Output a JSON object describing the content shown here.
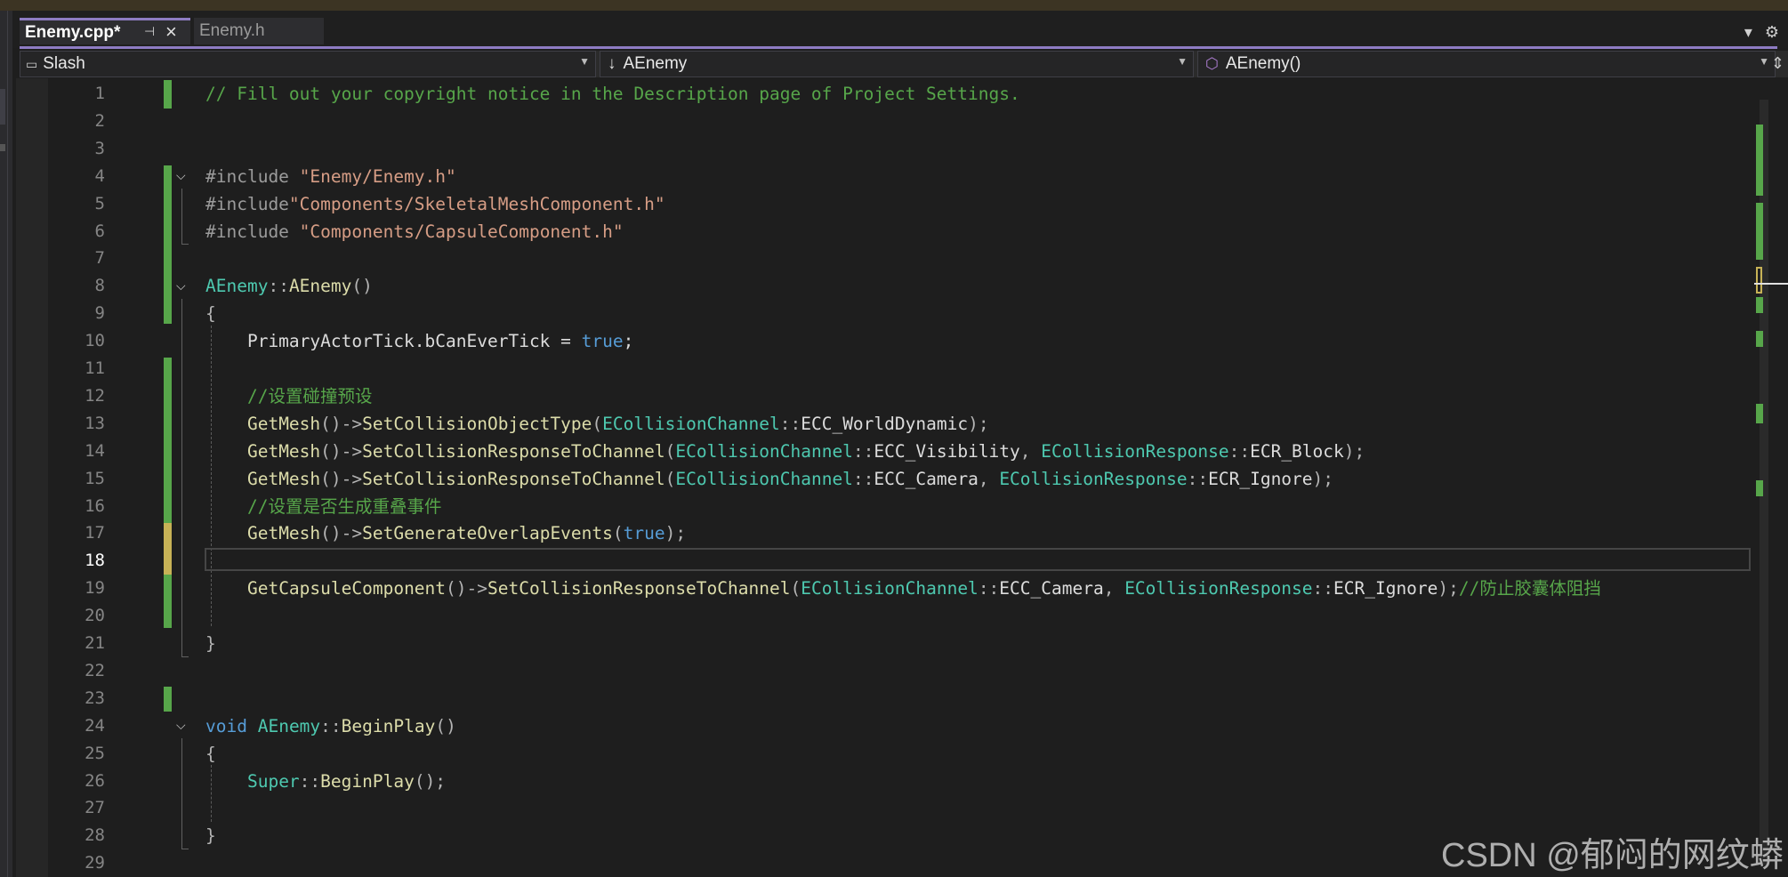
{
  "tabs": [
    {
      "label": "Enemy.cpp*",
      "active": true
    },
    {
      "label": "Enemy.h",
      "active": false
    }
  ],
  "navbar": {
    "project": "Slash",
    "scope": "AEnemy",
    "member": "AEnemy()"
  },
  "editor": {
    "current_line": 18,
    "lines": [
      {
        "n": "1",
        "segs": [
          {
            "t": "// Fill out your copyright notice in the Description page of Project Settings.",
            "c": "cmt"
          }
        ]
      },
      {
        "n": "2",
        "segs": []
      },
      {
        "n": "3",
        "segs": []
      },
      {
        "n": "4",
        "segs": [
          {
            "t": "#include ",
            "c": "inc"
          },
          {
            "t": "\"Enemy/Enemy.h\"",
            "c": "str"
          }
        ]
      },
      {
        "n": "5",
        "segs": [
          {
            "t": "#include",
            "c": "inc"
          },
          {
            "t": "\"Components/SkeletalMeshComponent.h\"",
            "c": "str"
          }
        ]
      },
      {
        "n": "6",
        "segs": [
          {
            "t": "#include ",
            "c": "inc"
          },
          {
            "t": "\"Components/CapsuleComponent.h\"",
            "c": "str"
          }
        ]
      },
      {
        "n": "7",
        "segs": []
      },
      {
        "n": "8",
        "segs": [
          {
            "t": "AEnemy",
            "c": "type"
          },
          {
            "t": "::",
            "c": "op"
          },
          {
            "t": "AEnemy",
            "c": "fn"
          },
          {
            "t": "()",
            "c": "op"
          }
        ]
      },
      {
        "n": "9",
        "segs": [
          {
            "t": "{",
            "c": "op"
          }
        ]
      },
      {
        "n": "10",
        "segs": [
          {
            "t": "    PrimaryActorTick.bCanEverTick = ",
            "c": ""
          },
          {
            "t": "true",
            "c": "kw"
          },
          {
            "t": ";",
            "c": ""
          }
        ]
      },
      {
        "n": "11",
        "segs": []
      },
      {
        "n": "12",
        "segs": [
          {
            "t": "    //设置碰撞预设",
            "c": "cmt"
          }
        ]
      },
      {
        "n": "13",
        "segs": [
          {
            "t": "    ",
            "c": ""
          },
          {
            "t": "GetMesh",
            "c": "fn"
          },
          {
            "t": "()->",
            "c": "op"
          },
          {
            "t": "SetCollisionObjectType",
            "c": "fn"
          },
          {
            "t": "(",
            "c": "op"
          },
          {
            "t": "ECollisionChannel",
            "c": "type"
          },
          {
            "t": "::",
            "c": "op"
          },
          {
            "t": "ECC_WorldDynamic",
            "c": ""
          },
          {
            "t": ");",
            "c": "op"
          }
        ]
      },
      {
        "n": "14",
        "segs": [
          {
            "t": "    ",
            "c": ""
          },
          {
            "t": "GetMesh",
            "c": "fn"
          },
          {
            "t": "()->",
            "c": "op"
          },
          {
            "t": "SetCollisionResponseToChannel",
            "c": "fn"
          },
          {
            "t": "(",
            "c": "op"
          },
          {
            "t": "ECollisionChannel",
            "c": "type"
          },
          {
            "t": "::",
            "c": "op"
          },
          {
            "t": "ECC_Visibility",
            "c": ""
          },
          {
            "t": ", ",
            "c": "op"
          },
          {
            "t": "ECollisionResponse",
            "c": "type"
          },
          {
            "t": "::",
            "c": "op"
          },
          {
            "t": "ECR_Block",
            "c": ""
          },
          {
            "t": ");",
            "c": "op"
          }
        ]
      },
      {
        "n": "15",
        "segs": [
          {
            "t": "    ",
            "c": ""
          },
          {
            "t": "GetMesh",
            "c": "fn"
          },
          {
            "t": "()->",
            "c": "op"
          },
          {
            "t": "SetCollisionResponseToChannel",
            "c": "fn"
          },
          {
            "t": "(",
            "c": "op"
          },
          {
            "t": "ECollisionChannel",
            "c": "type"
          },
          {
            "t": "::",
            "c": "op"
          },
          {
            "t": "ECC_Camera",
            "c": ""
          },
          {
            "t": ", ",
            "c": "op"
          },
          {
            "t": "ECollisionResponse",
            "c": "type"
          },
          {
            "t": "::",
            "c": "op"
          },
          {
            "t": "ECR_Ignore",
            "c": ""
          },
          {
            "t": ");",
            "c": "op"
          }
        ]
      },
      {
        "n": "16",
        "segs": [
          {
            "t": "    //设置是否生成重叠事件",
            "c": "cmt"
          }
        ]
      },
      {
        "n": "17",
        "segs": [
          {
            "t": "    ",
            "c": ""
          },
          {
            "t": "GetMesh",
            "c": "fn"
          },
          {
            "t": "()->",
            "c": "op"
          },
          {
            "t": "SetGenerateOverlapEvents",
            "c": "fn"
          },
          {
            "t": "(",
            "c": "op"
          },
          {
            "t": "true",
            "c": "kw"
          },
          {
            "t": ");",
            "c": "op"
          }
        ]
      },
      {
        "n": "18",
        "segs": []
      },
      {
        "n": "19",
        "segs": [
          {
            "t": "    ",
            "c": ""
          },
          {
            "t": "GetCapsuleComponent",
            "c": "fn"
          },
          {
            "t": "()->",
            "c": "op"
          },
          {
            "t": "SetCollisionResponseToChannel",
            "c": "fn"
          },
          {
            "t": "(",
            "c": "op"
          },
          {
            "t": "ECollisionChannel",
            "c": "type"
          },
          {
            "t": "::",
            "c": "op"
          },
          {
            "t": "ECC_Camera",
            "c": ""
          },
          {
            "t": ", ",
            "c": "op"
          },
          {
            "t": "ECollisionResponse",
            "c": "type"
          },
          {
            "t": "::",
            "c": "op"
          },
          {
            "t": "ECR_Ignore",
            "c": ""
          },
          {
            "t": ");",
            "c": "op"
          },
          {
            "t": "//防止胶囊体阻挡",
            "c": "cmt"
          }
        ]
      },
      {
        "n": "20",
        "segs": []
      },
      {
        "n": "21",
        "segs": [
          {
            "t": "}",
            "c": "op"
          }
        ]
      },
      {
        "n": "22",
        "segs": []
      },
      {
        "n": "23",
        "segs": []
      },
      {
        "n": "24",
        "segs": [
          {
            "t": "void",
            "c": "kw"
          },
          {
            "t": " ",
            "c": ""
          },
          {
            "t": "AEnemy",
            "c": "type"
          },
          {
            "t": "::",
            "c": "op"
          },
          {
            "t": "BeginPlay",
            "c": "fn"
          },
          {
            "t": "()",
            "c": "op"
          }
        ]
      },
      {
        "n": "25",
        "segs": [
          {
            "t": "{",
            "c": "op"
          }
        ]
      },
      {
        "n": "26",
        "segs": [
          {
            "t": "    ",
            "c": ""
          },
          {
            "t": "Super",
            "c": "type"
          },
          {
            "t": "::",
            "c": "op"
          },
          {
            "t": "BeginPlay",
            "c": "fn"
          },
          {
            "t": "();",
            "c": "op"
          }
        ]
      },
      {
        "n": "27",
        "segs": []
      },
      {
        "n": "28",
        "segs": [
          {
            "t": "}",
            "c": "op"
          }
        ]
      },
      {
        "n": "29",
        "segs": []
      }
    ]
  },
  "watermark": "CSDN @郁闷的网纹蟒",
  "colors": {
    "accent": "#8e7cc3",
    "comment": "#57a64a",
    "keyword": "#569cd6",
    "string": "#d69d85",
    "type": "#4ec9b0",
    "function": "#dcdcaa",
    "change_saved": "#57a64a",
    "change_unsaved": "#c7b256"
  }
}
